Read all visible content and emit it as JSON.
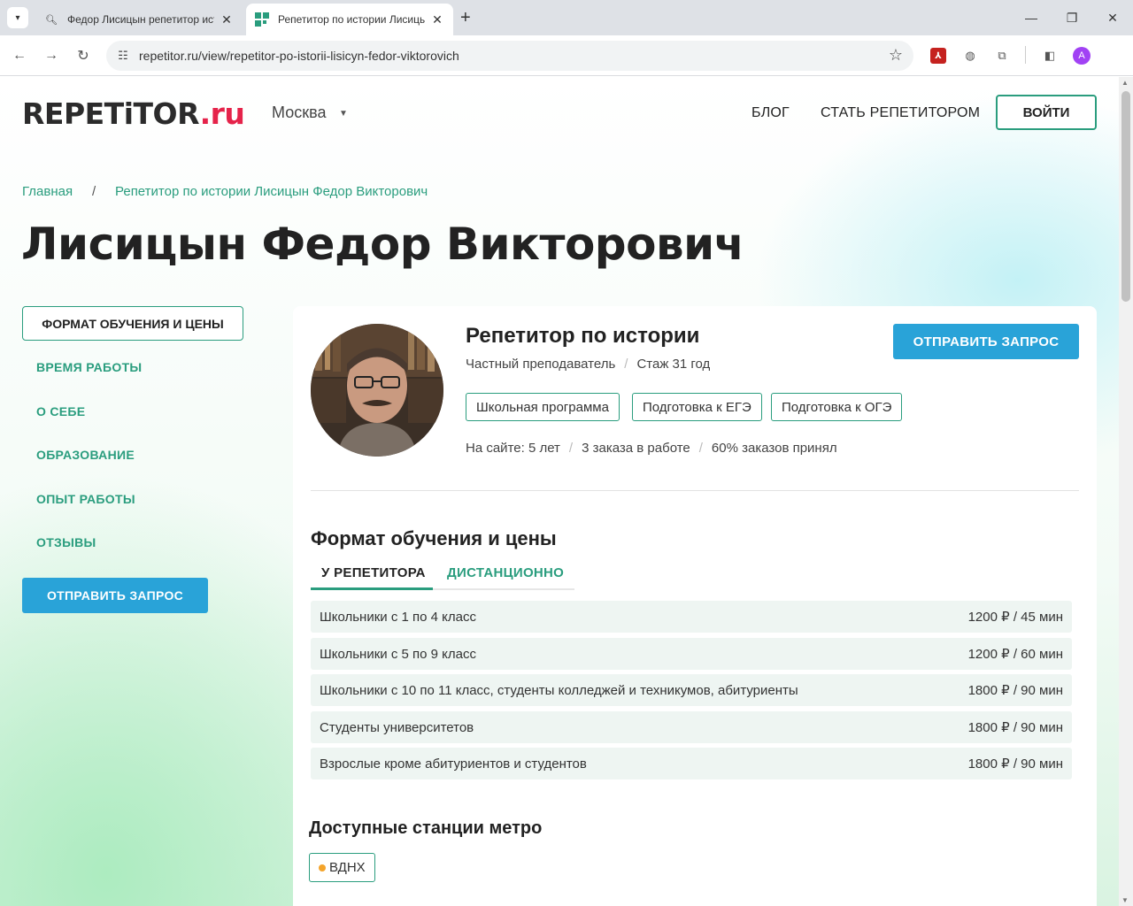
{
  "browser": {
    "tabs": [
      {
        "title": "Федор Лисицын репетитор ист",
        "active": false
      },
      {
        "title": "Репетитор по истории Лисицын",
        "active": true
      }
    ],
    "url": "repetitor.ru/view/repetitor-po-istorii-lisicyn-fedor-viktorovich",
    "profile_initial": "A",
    "icons": [
      "back-icon",
      "forward-icon",
      "reload-icon",
      "site-info-icon",
      "star-icon",
      "pdf-extension-icon",
      "globe-extension-icon",
      "extensions-icon",
      "side-panel-icon",
      "profile-avatar"
    ]
  },
  "header": {
    "logo_main": "REPETiTOR",
    "logo_tld": ".ru",
    "city": "Москва",
    "nav": [
      "БЛОГ",
      "СТАТЬ РЕПЕТИТОРОМ"
    ],
    "login": "ВОЙТИ"
  },
  "breadcrumbs": {
    "home": "Главная",
    "separator": "/",
    "current": "Репетитор по истории Лисицын Федор Викторович"
  },
  "page_title": "Лисицын Федор Викторович",
  "sidebar": {
    "active": "ФОРМАТ ОБУЧЕНИЯ И ЦЕНЫ",
    "items": [
      "ВРЕМЯ РАБОТЫ",
      "О СЕБЕ",
      "ОБРАЗОВАНИЕ",
      "ОПЫТ РАБОТЫ",
      "ОТЗЫВЫ"
    ],
    "send": "ОТПРАВИТЬ ЗАПРОС"
  },
  "profile": {
    "role": "Репетитор по истории",
    "type": "Частный преподаватель",
    "experience": "Стаж 31 год",
    "chips": [
      "Школьная программа",
      "Подготовка к ЕГЭ",
      "Подготовка к ОГЭ"
    ],
    "stats": [
      "На сайте: 5 лет",
      "3 заказа в работе",
      "60% заказов принял"
    ],
    "send": "ОТПРАВИТЬ ЗАПРОС"
  },
  "pricing": {
    "title": "Формат обучения и цены",
    "tabs": [
      "У РЕПЕТИТОРА",
      "ДИСТАНЦИОННО"
    ],
    "rows": [
      {
        "label": "Школьники с 1 по 4 класс",
        "price": "1200 ₽ / 45 мин"
      },
      {
        "label": "Школьники с 5 по 9 класс",
        "price": "1200 ₽ / 60 мин"
      },
      {
        "label": "Школьники с 10 по 11 класс, студенты колледжей и техникумов, абитуриенты",
        "price": "1800 ₽ / 90 мин"
      },
      {
        "label": "Студенты университетов",
        "price": "1800 ₽ / 90 мин"
      },
      {
        "label": "Взрослые кроме абитуриентов и студентов",
        "price": "1800 ₽ / 90 мин"
      }
    ]
  },
  "metro": {
    "title": "Доступные станции метро",
    "stations": [
      "ВДНХ"
    ],
    "dot_color": "#f4a42b"
  },
  "colors": {
    "accent_green": "#2a9d7e",
    "accent_blue": "#29a3d8",
    "logo_red": "#e5234a"
  }
}
